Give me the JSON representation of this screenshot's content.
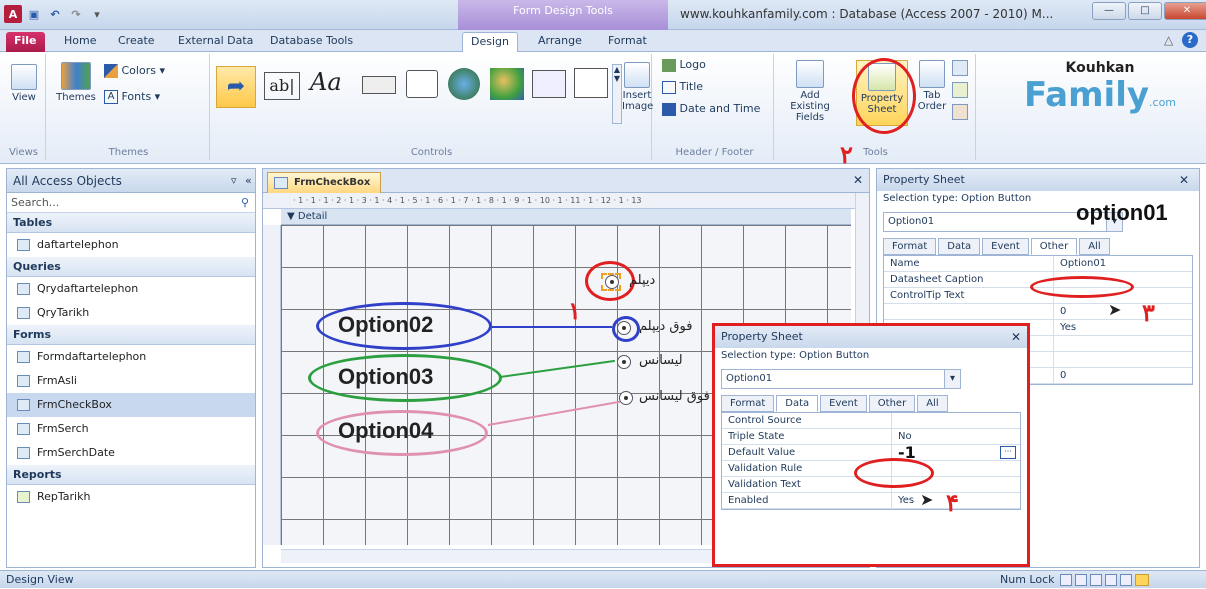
{
  "window": {
    "title": "www.kouhkanfamily.com : Database (Access 2007 - 2010) M...",
    "context_band": "Form Design Tools",
    "qat_logo": "A"
  },
  "tabs": [
    "File",
    "Home",
    "Create",
    "External Data",
    "Database Tools",
    "Design",
    "Arrange",
    "Format"
  ],
  "ribbon": {
    "views": {
      "button": "View",
      "group": "Views"
    },
    "themes": {
      "themes": "Themes",
      "colors": "Colors",
      "fonts": "Fonts",
      "group": "Themes"
    },
    "controls": {
      "group": "Controls",
      "insert_image": "Insert Image"
    },
    "header_footer": {
      "logo": "Logo",
      "title": "Title",
      "date_time": "Date and Time",
      "group": "Header / Footer"
    },
    "tools": {
      "add_fields": "Add Existing Fields",
      "property_sheet": "Property Sheet",
      "tab_order": "Tab Order",
      "group": "Tools"
    },
    "brand": {
      "line1": "Kouhkan",
      "line2": "Family",
      "suffix": ".com"
    }
  },
  "nav": {
    "title": "All Access Objects",
    "search": "Search...",
    "sections": [
      {
        "name": "Tables",
        "items": [
          "daftartelephon"
        ]
      },
      {
        "name": "Queries",
        "items": [
          "Qrydaftartelephon",
          "QryTarikh"
        ]
      },
      {
        "name": "Forms",
        "items": [
          "Formdaftartelephon",
          "FrmAsli",
          "FrmCheckBox",
          "FrmSerch",
          "FrmSerchDate"
        ]
      },
      {
        "name": "Reports",
        "items": [
          "RepTarikh"
        ]
      }
    ],
    "selected": "FrmCheckBox"
  },
  "document": {
    "tab": "FrmCheckBox",
    "ruler": "· 1 · 1 · 1 · 2 · 1 · 3 · 1 · 4 · 1 · 5 · 1 · 6 · 1 · 7 · 1 · 8 · 1 · 9 · 1 · 10 · 1 · 11 · 1 · 12 · 1 · 13",
    "section": "Detail",
    "labels": [
      "دیپلم",
      "فوق دیپلم",
      "لیسانس",
      "فوق لیسانس"
    ]
  },
  "annotations": {
    "big_name": "option01",
    "ovals": [
      "Option02",
      "Option03",
      "Option04"
    ],
    "numbers": [
      "۱",
      "۲",
      "۳",
      "۴"
    ]
  },
  "property_sheet": {
    "title": "Property Sheet",
    "selection": "Selection type:  Option Button",
    "combo": "Option01",
    "tabs": [
      "Format",
      "Data",
      "Event",
      "Other",
      "All"
    ],
    "active_tab": "Other",
    "rows": [
      {
        "k": "Name",
        "v": "Option01"
      },
      {
        "k": "Datasheet Caption",
        "v": ""
      },
      {
        "k": "ControlTip Text",
        "v": ""
      },
      {
        "k": "",
        "v": "0"
      },
      {
        "k": "",
        "v": "Yes"
      },
      {
        "k": "",
        "v": ""
      },
      {
        "k": "",
        "v": ""
      },
      {
        "k": "",
        "v": "0"
      }
    ]
  },
  "popup": {
    "title": "Property Sheet",
    "selection": "Selection type:  Option Button",
    "combo": "Option01",
    "tabs": [
      "Format",
      "Data",
      "Event",
      "Other",
      "All"
    ],
    "active_tab": "Data",
    "rows": [
      {
        "k": "Control Source",
        "v": ""
      },
      {
        "k": "Triple State",
        "v": "No"
      },
      {
        "k": "Default Value",
        "v": "-1"
      },
      {
        "k": "Validation Rule",
        "v": ""
      },
      {
        "k": "Validation Text",
        "v": ""
      },
      {
        "k": "Enabled",
        "v": "Yes"
      }
    ]
  },
  "status": {
    "left": "Design View",
    "right": "Num Lock"
  },
  "colors": {
    "annotation_red": "#e02020",
    "oval_blue": "#3040c8",
    "oval_green": "#2ca040",
    "oval_pink": "#e090b0"
  }
}
